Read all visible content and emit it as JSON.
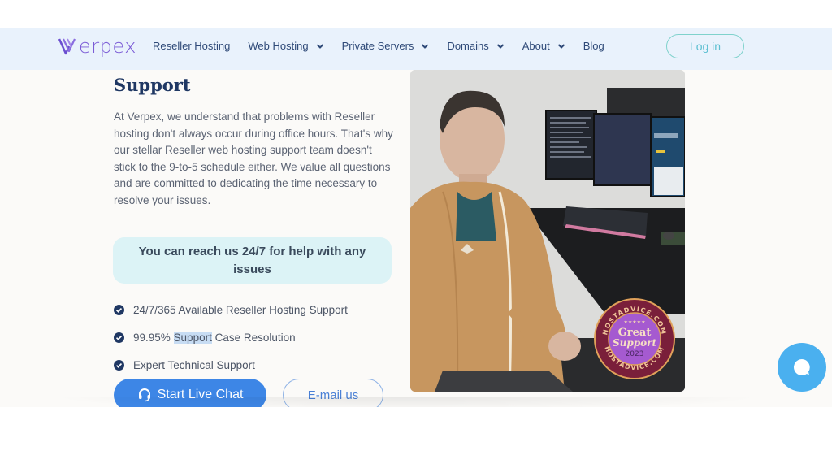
{
  "nav": {
    "logo_text": "erpex",
    "brand_color": "#7b5cd6",
    "items": [
      {
        "label": "Reseller Hosting",
        "has_dropdown": false
      },
      {
        "label": "Web Hosting",
        "has_dropdown": true
      },
      {
        "label": "Private Servers",
        "has_dropdown": true
      },
      {
        "label": "Domains",
        "has_dropdown": true
      },
      {
        "label": "About",
        "has_dropdown": true
      },
      {
        "label": "Blog",
        "has_dropdown": false
      }
    ],
    "login_label": "Log in"
  },
  "section": {
    "heading": "Support",
    "paragraph": "At Verpex, we understand that problems with Reseller hosting don't always occur during office hours. That's why our stellar Reseller web hosting support team doesn't stick to the 9-to-5 schedule either. We value all questions and are committed to dedicating the time necessary to resolve your issues.",
    "callout": "You can reach us 24/7 for help with any issues",
    "features": [
      {
        "before": "24/7/365 Available Reseller Hosting Support",
        "highlight": "",
        "after": ""
      },
      {
        "before": "99.95% ",
        "highlight": "Support",
        "after": " Case Resolution"
      },
      {
        "before": "Expert Technical Support",
        "highlight": "",
        "after": ""
      }
    ],
    "chat_button": "Start Live Chat",
    "email_button": "E-mail us"
  },
  "badge": {
    "top_text": "HOSTADVICE.COM",
    "title_line1": "Great",
    "title_line2": "Support",
    "year": "2023",
    "bottom_text": "HOSTADVICE.COM",
    "stars": "★★★★★"
  },
  "icons": {
    "check": "check-circle-icon",
    "headset": "headset-icon",
    "chevron": "chevron-down-icon",
    "chat": "chat-bubble-icon"
  }
}
